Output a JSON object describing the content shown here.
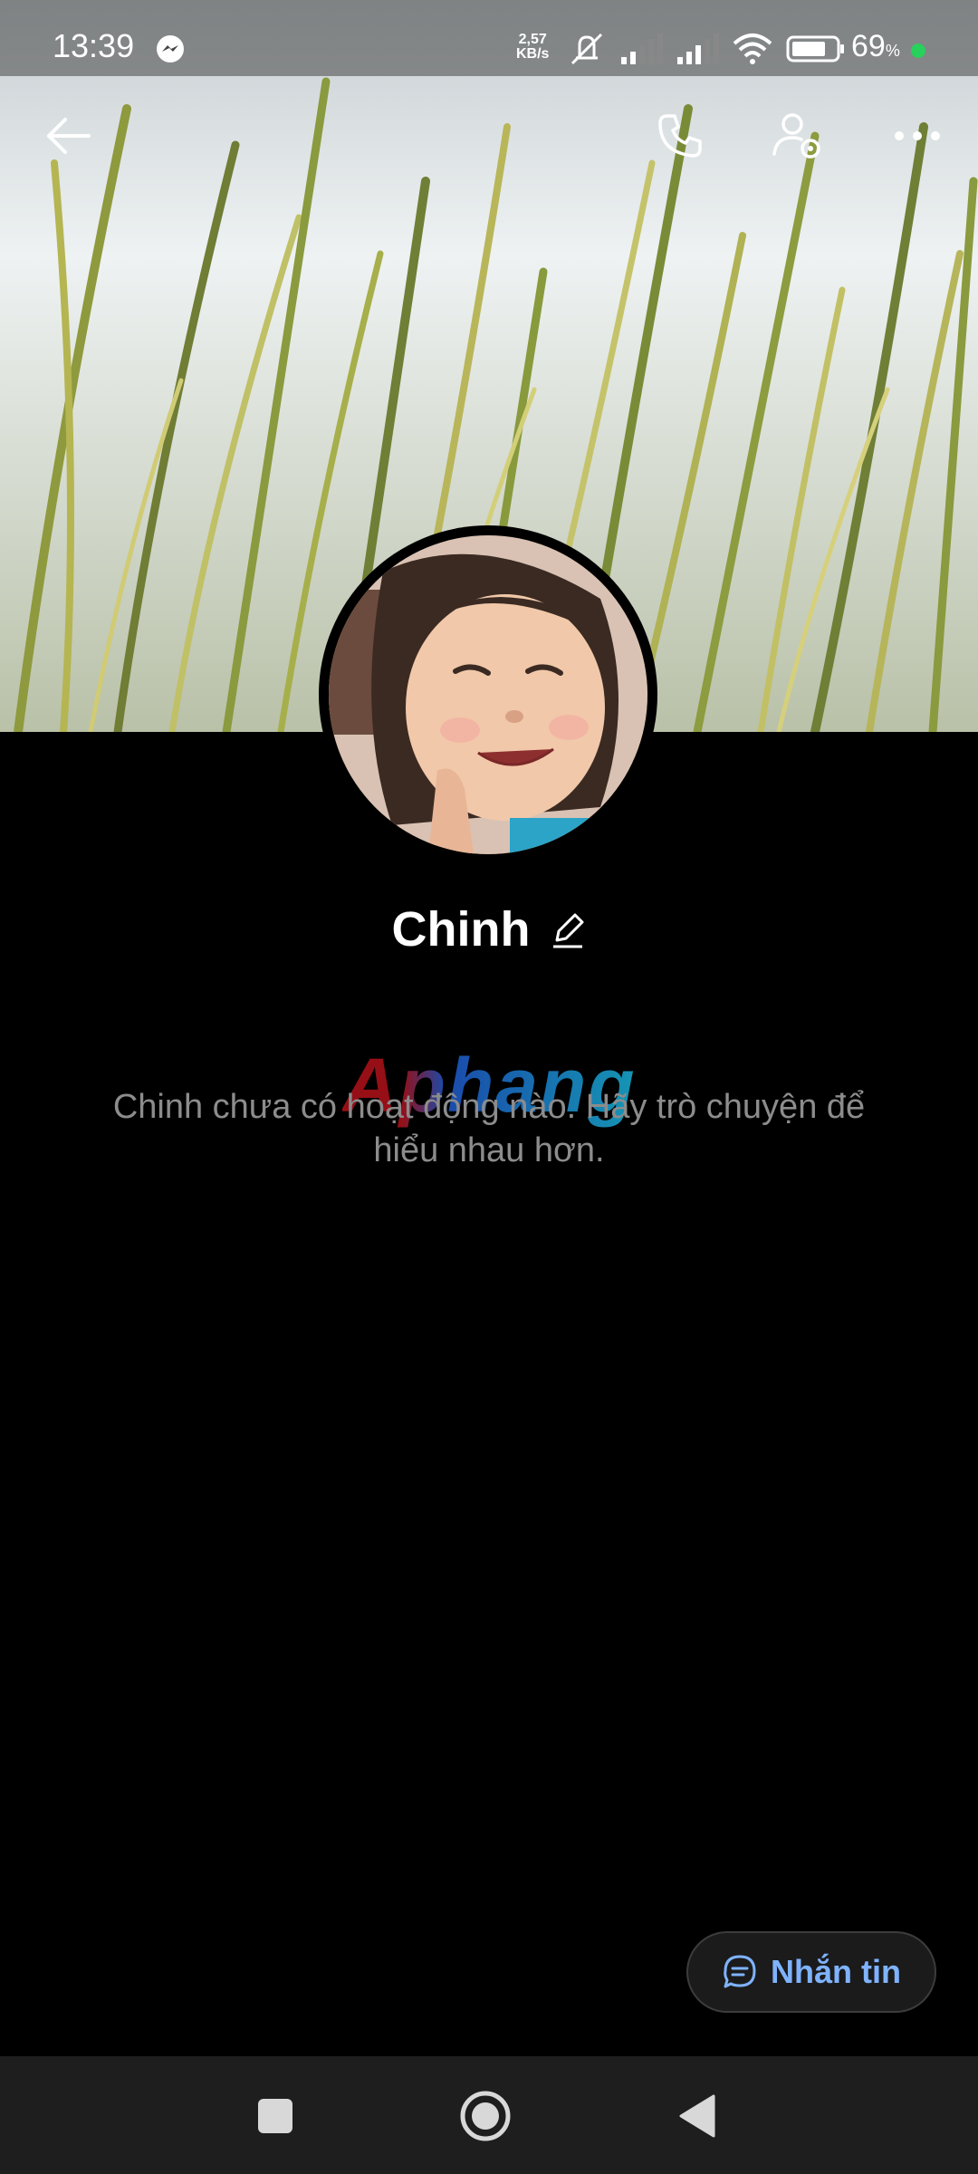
{
  "status_bar": {
    "time": "13:39",
    "net_speed_value": "2,57",
    "net_speed_unit": "KB/s",
    "battery_percent": "69",
    "battery_unit": "%"
  },
  "profile": {
    "name": "Chinh",
    "empty_message": "Chinh chưa có hoạt động nào. Hãy trò chuyện để hiểu nhau hơn."
  },
  "watermark": {
    "text": "Aphang"
  },
  "actions": {
    "message_label": "Nhắn tin"
  },
  "colors": {
    "background": "#000000",
    "accent": "#7fb3ff",
    "battery_dot": "#27d15b"
  },
  "icons": [
    "back-arrow-icon",
    "phone-icon",
    "user-settings-icon",
    "more-icon",
    "edit-pencil-icon",
    "chat-bubble-icon",
    "messenger-icon",
    "recents-square-icon",
    "home-circle-icon",
    "back-triangle-icon"
  ]
}
